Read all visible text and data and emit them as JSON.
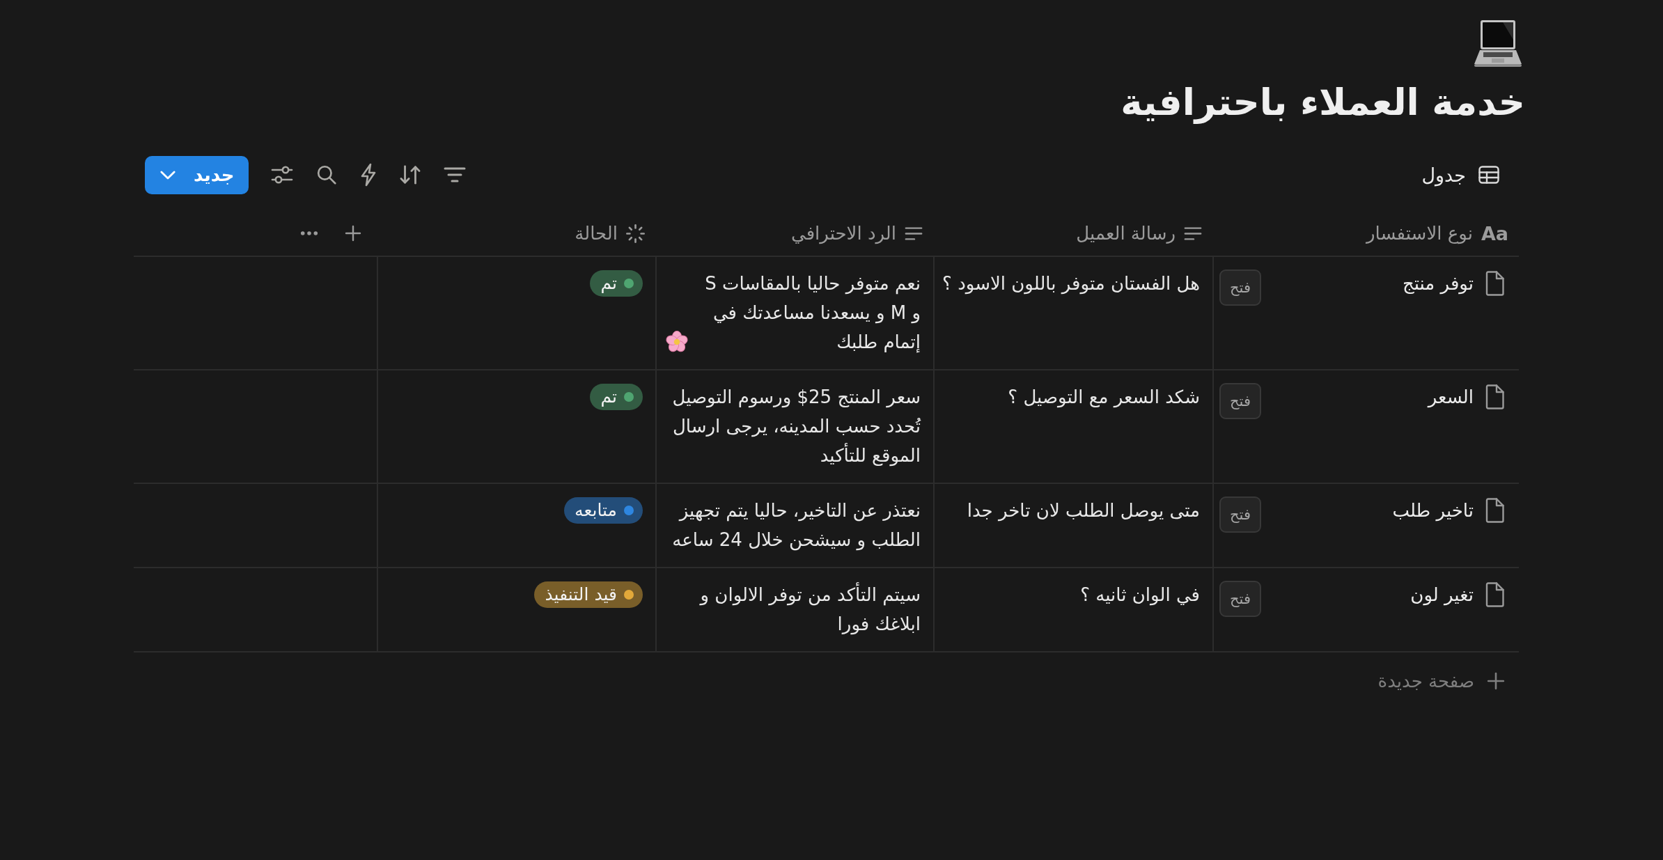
{
  "page": {
    "title": "خدمة العملاء باحترافية"
  },
  "toolbar": {
    "view": {
      "label": "جدول"
    },
    "new_button": {
      "label": "جديد"
    }
  },
  "table": {
    "columns": [
      {
        "name": "نوع الاستفسار",
        "kind": "title",
        "glyph": "Aa"
      },
      {
        "name": "رسالة العميل",
        "kind": "text"
      },
      {
        "name": "الرد الاحترافي",
        "kind": "text"
      },
      {
        "name": "الحالة",
        "kind": "status"
      }
    ],
    "rows": [
      {
        "title": "توفر منتج",
        "open_label": "فتح",
        "message": "هل الفستان متوفر باللون الاسود ؟",
        "reply": "نعم متوفر حاليا بالمقاسات S و M و يسعدنا مساعدتك في إتمام طلبك",
        "reply_emoji": true,
        "status": {
          "label": "تم",
          "color": "#4fa571"
        }
      },
      {
        "title": "السعر",
        "open_label": "فتح",
        "message": "شكد السعر مع التوصيل ؟",
        "reply": "سعر المنتج 25$ ورسوم التوصيل تُحدد حسب المدينه، يرجى ارسال الموقع للتأكيد",
        "reply_emoji": false,
        "status": {
          "label": "تم",
          "color": "#4fa571"
        }
      },
      {
        "title": "تاخير طلب",
        "open_label": "فتح",
        "message": "متى يوصل الطلب لان تاخر جدا",
        "reply": "نعتذر عن التاخير، حاليا يتم تجهيز الطلب و سيشحن خلال 24 ساعه",
        "reply_emoji": false,
        "status": {
          "label": "متابعه",
          "color": "#2e86e0"
        }
      },
      {
        "title": "تغير لون",
        "open_label": "فتح",
        "message": "في الوان ثانيه ؟",
        "reply": "سيتم التأكد من توفر الالوان و ابلاغك فورا",
        "reply_emoji": false,
        "status": {
          "label": "قيد التنفيذ",
          "color": "#e2a93a"
        }
      }
    ]
  },
  "new_page": {
    "label": "صفحة جديدة"
  }
}
